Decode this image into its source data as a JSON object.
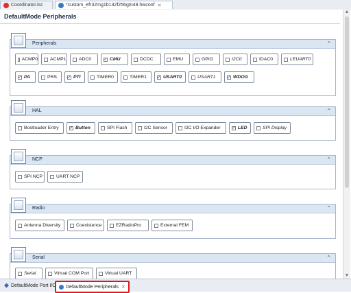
{
  "tabs": [
    {
      "label": "Coordinator.isc",
      "icon": "red-circle-icon"
    },
    {
      "label": "*custom_efr32mg1b132f256gm48.hwconf",
      "icon": "blue-circle-icon"
    }
  ],
  "editor_title": "DefaultMode Peripherals",
  "sections": [
    {
      "title": "Peripherals",
      "items": [
        {
          "label": "ACMP0",
          "checked": false
        },
        {
          "label": "ACMP1",
          "checked": false
        },
        {
          "label": "ADC0",
          "checked": false
        },
        {
          "label": "CMU",
          "checked": true
        },
        {
          "label": "DCDC",
          "checked": false
        },
        {
          "label": "EMU",
          "checked": false
        },
        {
          "label": "GPIO",
          "checked": false
        },
        {
          "label": "I2C0",
          "checked": false,
          "italic": true
        },
        {
          "label": "IDAC0",
          "checked": false
        },
        {
          "label": "LEUART0",
          "checked": false,
          "italic": true
        },
        {
          "label": "PA",
          "checked": true
        },
        {
          "label": "PRS",
          "checked": false
        },
        {
          "label": "PTI",
          "checked": true
        },
        {
          "label": "TIMER0",
          "checked": false
        },
        {
          "label": "TIMER1",
          "checked": false
        },
        {
          "label": "USART0",
          "checked": true
        },
        {
          "label": "USART1",
          "checked": false,
          "italic": true
        },
        {
          "label": "WDOG",
          "checked": true
        }
      ]
    },
    {
      "title": "HAL",
      "items": [
        {
          "label": "Bootloader Entry",
          "checked": false
        },
        {
          "label": "Button",
          "checked": true
        },
        {
          "label": "SPI Flash",
          "checked": false
        },
        {
          "label": "I2C Sensor",
          "checked": false
        },
        {
          "label": "I2C I/O Expander",
          "checked": false
        },
        {
          "label": "LED",
          "checked": true
        },
        {
          "label": "SPI Display",
          "checked": false,
          "italic": true
        }
      ]
    },
    {
      "title": "NCP",
      "items": [
        {
          "label": "SPI NCP",
          "checked": false
        },
        {
          "label": "UART NCP",
          "checked": false
        }
      ]
    },
    {
      "title": "Radio",
      "items": [
        {
          "label": "Antenna Diversity",
          "checked": false
        },
        {
          "label": "Coexistence",
          "checked": false
        },
        {
          "label": "EZRadioPro",
          "checked": false
        },
        {
          "label": "External FEM",
          "checked": false
        }
      ]
    },
    {
      "title": "Serial",
      "items": [
        {
          "label": "Serial",
          "checked": false,
          "italic": true
        },
        {
          "label": "Virtual COM Port",
          "checked": false
        },
        {
          "label": "Virtual UART",
          "checked": false
        }
      ]
    }
  ],
  "bottom_tabs": [
    {
      "label": "DefaultMode Port I/O",
      "icon": "port-io-icon"
    },
    {
      "label": "DefaultMode Peripherals",
      "icon": "peripherals-icon"
    }
  ],
  "colors": {
    "highlight": "#e0161b",
    "header_bg": "#dbe6f3"
  }
}
